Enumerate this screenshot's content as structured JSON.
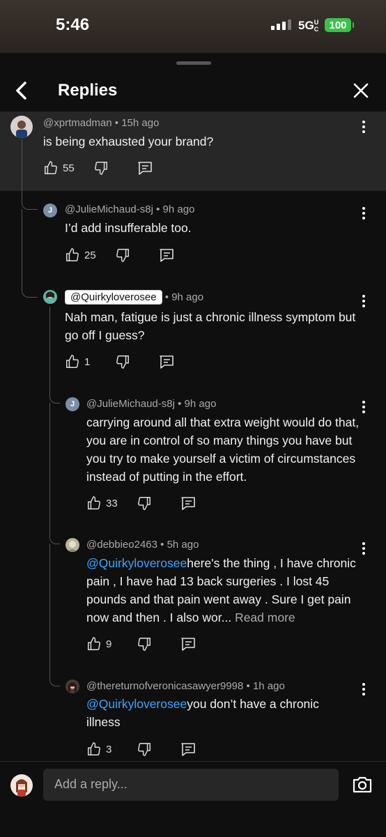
{
  "status": {
    "time": "5:46",
    "network": "5G",
    "network_suffix": "UC",
    "battery": "100"
  },
  "header": {
    "title": "Replies"
  },
  "comments": [
    {
      "author": "@xprtmadman",
      "age": "15h ago",
      "text": "is being exhausted your brand?",
      "likes": "55"
    },
    {
      "author": "@JulieMichaud-s8j",
      "age": "9h ago",
      "text": "I’d add insufferable too.",
      "likes": "25",
      "avatar_letter": "J"
    },
    {
      "author": "@Quirkyloverosee",
      "age": "9h ago",
      "text": "Nah man, fatigue is just a chronic illness symptom but go off I guess?",
      "likes": "1"
    },
    {
      "author": "@JulieMichaud-s8j",
      "age": "9h ago",
      "text": "carrying around all that extra weight would do that, you are in control of so many things you have but you try to make yourself a victim of circumstances instead of putting in the effort.",
      "likes": "33",
      "avatar_letter": "J"
    },
    {
      "author": "@debbieo2463",
      "age": "5h ago",
      "mention": "@Quirkyloverosee",
      "text": "here's the thing , I have chronic pain , I have had 13 back surgeries . I lost 45 pounds and that pain went away . Sure I get pain now and then . I also wor...",
      "read_more": "Read more",
      "likes": "9"
    },
    {
      "author": "@thereturnofveronicasawyer9998",
      "age": "1h ago",
      "mention": "@Quirkyloverosee",
      "text": "you don’t have a chronic illness",
      "likes": "3"
    }
  ],
  "composer": {
    "placeholder": "Add a reply..."
  },
  "icons": {
    "back": "chevron-left-icon",
    "close": "close-icon",
    "like": "thumbs-up-icon",
    "dislike": "thumbs-down-icon",
    "reply": "reply-icon",
    "more": "more-vertical-icon",
    "camera": "camera-icon"
  },
  "colors": {
    "link": "#3ea6ff",
    "battery": "#3ac24a",
    "highlight_bg": "#272727"
  }
}
